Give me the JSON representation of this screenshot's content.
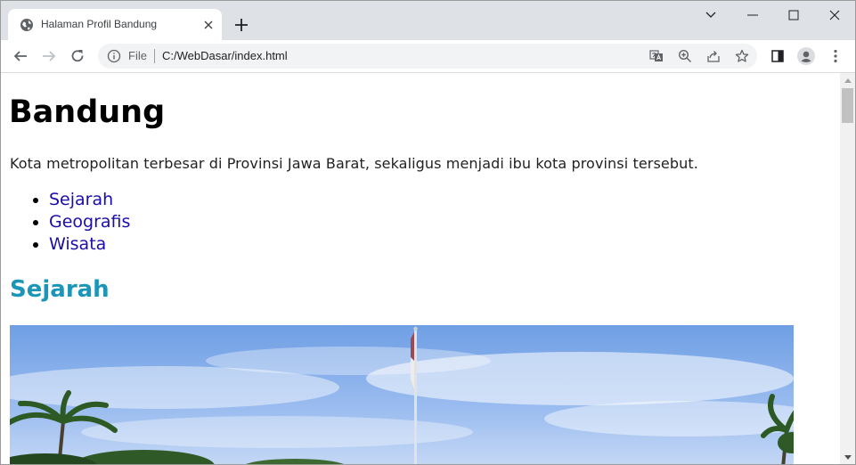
{
  "browser": {
    "tab": {
      "title": "Halaman Profil Bandung"
    },
    "address_bar": {
      "scheme_label": "File",
      "url": "C:/WebDasar/index.html"
    }
  },
  "page": {
    "title": "Bandung",
    "intro": "Kota metropolitan terbesar di Provinsi Jawa Barat, sekaligus menjadi ibu kota provinsi tersebut.",
    "nav_links": [
      "Sejarah",
      "Geografis",
      "Wisata"
    ],
    "section_heading": "Sejarah"
  },
  "colors": {
    "tabstrip_bg": "#dee1e6",
    "link": "#1a0dab",
    "section_heading": "#1b96b8"
  }
}
